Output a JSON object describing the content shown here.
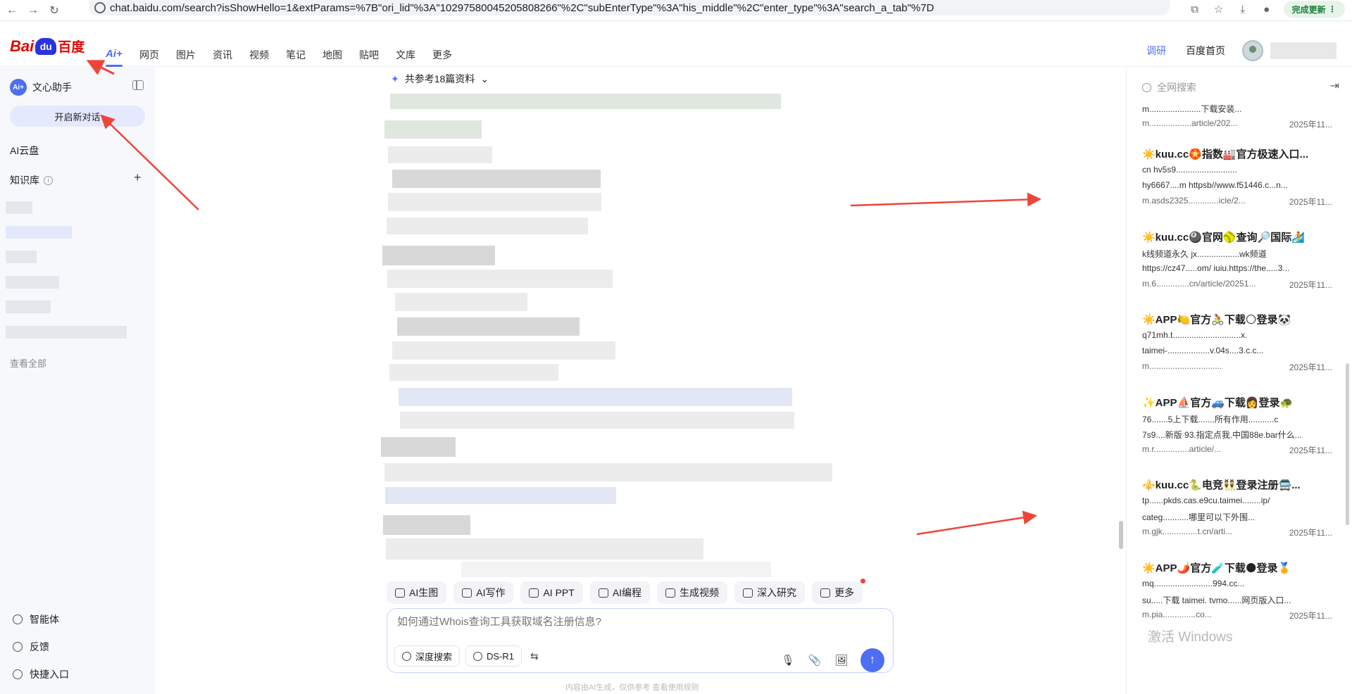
{
  "browser": {
    "url": "chat.baidu.com/search?isShowHello=1&extParams=%7B\"ori_lid\"%3A\"10297580045205808266\"%2C\"subEnterType\"%3A\"his_middle\"%2C\"enter_type\"%3A\"search_a_tab\"%7D",
    "update_label": "完成更新"
  },
  "header": {
    "logo_bai": "Bai",
    "logo_du": "du",
    "logo_cn": "百度",
    "ai_tab": "Ai+",
    "tabs": [
      "网页",
      "图片",
      "资讯",
      "视频",
      "笔记",
      "地图",
      "贴吧",
      "文库",
      "更多"
    ],
    "research": "调研",
    "home": "百度首页"
  },
  "sidebar": {
    "assistant_badge": "Ai+",
    "assistant_name": "文心助手",
    "new_chat": "开启新对话",
    "ai_cloud": "AI云盘",
    "knowledge_base": "知识库",
    "view_all": "查看全部",
    "bottom": [
      "智能体",
      "反馈",
      "快捷入口"
    ]
  },
  "main": {
    "references": "共参考18篇资料",
    "tools": [
      "AI生图",
      "AI写作",
      "AI PPT",
      "AI编程",
      "生成视频",
      "深入研究",
      "更多"
    ],
    "input_placeholder": "如何通过Whois查询工具获取域名注册信息?",
    "deep_search": "深度搜索",
    "model": "DS-R1",
    "disclaimer": "内容由AI生成，仅供参考    查看使用规则"
  },
  "right_panel": {
    "search_label": "全网搜索",
    "results": [
      {
        "title": "",
        "line1": "m......................下载安装...",
        "source": "m..................article/202...",
        "date": "2025年11..."
      },
      {
        "title": "☀️kuu.cc🏵️指数🏭官方极速入口...",
        "line1": "cn hv5s9..........................",
        "line2": "hy6667....m httpsb//www.f51446.c...n...",
        "source": "m.asds2325.............icle/2...",
        "date": "2025年11..."
      },
      {
        "title": "☀️kuu.cc🎱官网🥎查询🔎国际🏄",
        "line1": "k线频道永久 jx..................wk频道",
        "line2": "https://cz47.....om/ iuiu.https://the.....3...",
        "source": "m.6..............cn/article/20251...",
        "date": "2025年11..."
      },
      {
        "title": "☀️APP🍋官方🚴下载🌕登录🐼",
        "line1": "q71mh.t.............................x.",
        "line2": "taimei-..................v.04s....3.c.c...",
        "source": "m...............................",
        "date": "2025年11..."
      },
      {
        "title": "✨APP⛵官方🚙下载👩登录🐢",
        "line1": "76.......5上下载.......所有作用...........c",
        "line2": "7s9....新版 93.指定点我.中国88e.bar什么...",
        "source": "m.r...............article/...",
        "date": "2025年11..."
      },
      {
        "title": "⚜️kuu.cc🐍电竞👯登录注册🚍...",
        "line1": "tp......pkds.cas.e9cu.taimei........ip/",
        "line2": "categ...........哪里可以下外围...",
        "source": "m.gjk...............t.cn/arti...",
        "date": "2025年11..."
      },
      {
        "title": "☀️APP🌶️官方🧪下载🌑登录🏅",
        "line1": "mq.........................994.cc...",
        "line2": "su.....下载 taimei. tvmo......网页版入口...",
        "source": "m.pia..............co...",
        "date": "2025年11..."
      }
    ],
    "watermark": "激活 Windows"
  },
  "colors": {
    "accent": "#4e6ef2",
    "brand_red": "#e10601",
    "annotation_arrow": "#f04438"
  }
}
